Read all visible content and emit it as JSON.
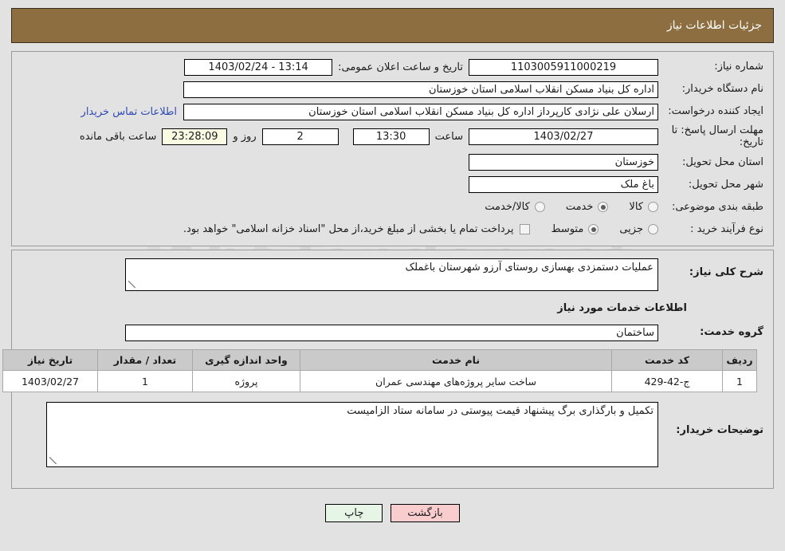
{
  "header": {
    "title": "جزئیات اطلاعات نیاز"
  },
  "top_form": {
    "need_number_label": "شماره نیاز:",
    "need_number_value": "1103005911000219",
    "public_announce_label": "تاریخ و ساعت اعلان عمومی:",
    "public_announce_value": "1403/02/24 - 13:14",
    "buyer_org_label": "نام دستگاه خریدار:",
    "buyer_org_value": "اداره کل بنیاد مسکن انقلاب اسلامی استان خوزستان",
    "creator_label": "ایجاد کننده درخواست:",
    "creator_value": "ارسلان علی نژادی کارپرداز اداره کل بنیاد مسکن انقلاب اسلامی استان خوزستان",
    "contact_link": "اطلاعات تماس خریدار",
    "deadline_label": "مهلت ارسال پاسخ: تا تاریخ:",
    "deadline_date": "1403/02/27",
    "hour_label": "ساعت",
    "deadline_hour": "13:30",
    "days_value": "2",
    "days_label": "روز و",
    "timer_value": "23:28:09",
    "remaining_label": "ساعت باقی مانده",
    "province_label": "استان محل تحویل:",
    "province_value": "خوزستان",
    "city_label": "شهر محل تحویل:",
    "city_value": "باغ ملک",
    "category_label": "طبقه بندی موضوعی:",
    "category_options": [
      {
        "label": "کالا",
        "selected": false
      },
      {
        "label": "خدمت",
        "selected": true
      },
      {
        "label": "کالا/خدمت",
        "selected": false
      }
    ],
    "process_label": "نوع فرآیند خرید :",
    "process_options": [
      {
        "label": "جزیی",
        "selected": false
      },
      {
        "label": "متوسط",
        "selected": true
      }
    ],
    "treasury_checkbox_checked": false,
    "treasury_note": "پرداخت تمام یا بخشی از مبلغ خرید،از محل \"اسناد خزانه اسلامی\" خواهد بود."
  },
  "mid_form": {
    "description_label": "شرح کلی نیاز:",
    "description_value": "عملیات دستمزدی بهسازی روستای آرزو شهرستان باغملک",
    "services_section_title": "اطلاعات خدمات مورد نیاز",
    "service_group_label": "گروه خدمت:",
    "service_group_value": "ساختمان",
    "notes_label": "توضیحات خریدار:",
    "notes_value": "تکمیل و بارگذاری برگ پیشنهاد قیمت پیوستی در سامانه ستاد الزامیست"
  },
  "table": {
    "columns": [
      "ردیف",
      "کد خدمت",
      "نام خدمت",
      "واحد اندازه گیری",
      "تعداد / مقدار",
      "تاریخ نیاز"
    ],
    "rows": [
      {
        "radif": "1",
        "code": "ج-42-429",
        "name": "ساخت سایر پروژه‌های مهندسی عمران",
        "unit": "پروژه",
        "qty": "1",
        "date": "1403/02/27"
      }
    ]
  },
  "footer": {
    "print_label": "چاپ",
    "back_label": "بازگشت"
  },
  "watermark": {
    "text": "AhaTender.net"
  },
  "colors": {
    "header_bg": "#8d6e41",
    "page_bg": "#e2e2e2",
    "link": "#2f4ab5",
    "timer_bg": "#fbfbe4",
    "table_header_bg": "#cacaca",
    "print_btn_bg": "#e6f5e6",
    "back_btn_bg": "#f9ccce"
  }
}
